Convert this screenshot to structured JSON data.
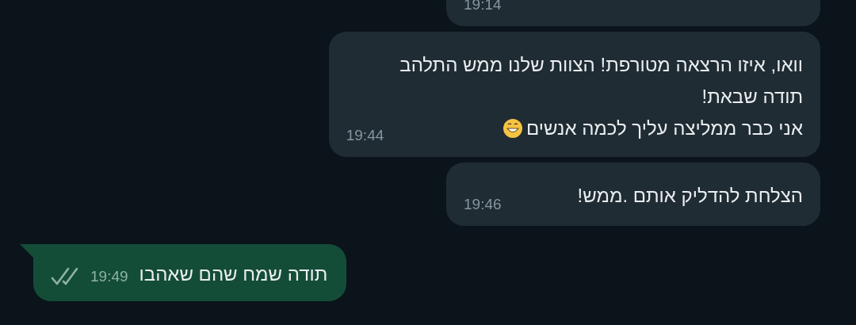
{
  "messages": [
    {
      "kind": "incoming",
      "time": "19:14"
    },
    {
      "kind": "incoming",
      "lines": [
        "וואו, איזו הרצאה מטורפת! הצוות שלנו ממש התלהב",
        "תודה שבאת!",
        "אני כבר ממליצה עליך לכמה אנשים"
      ],
      "trailing_emoji": true,
      "time": "19:44"
    },
    {
      "kind": "incoming",
      "lines": [
        "הצלחת להדליק אותם .ממש!"
      ],
      "time": "19:46"
    },
    {
      "kind": "outgoing",
      "lines": [
        "תודה שמח שהם שאהבו"
      ],
      "time": "19:49",
      "read": false
    }
  ]
}
